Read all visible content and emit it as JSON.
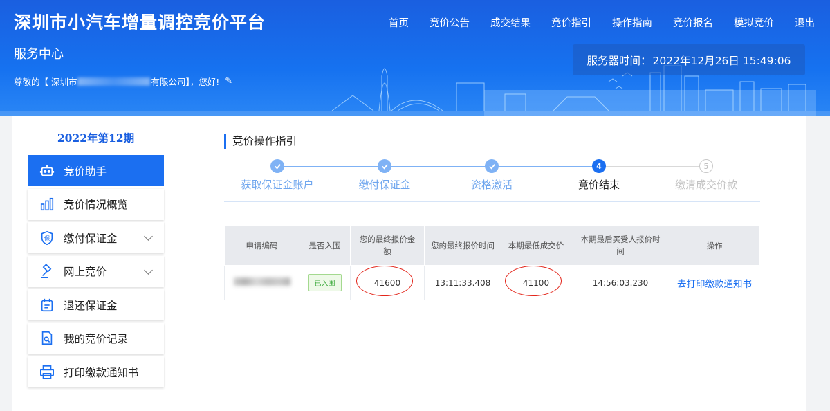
{
  "header": {
    "site_title": "深圳市小汽车增量调控竞价平台",
    "sub_title": "服务中心",
    "greeting_prefix": "尊敬的【 深圳市",
    "greeting_suffix": "有限公司】，您好!",
    "server_time_label": "服务器时间：",
    "server_time_value": "2022年12月26日 15:49:06"
  },
  "nav": [
    "首页",
    "竞价公告",
    "成交结果",
    "竞价指引",
    "操作指南",
    "竞价报名",
    "模拟竞价",
    "退出"
  ],
  "sidebar": {
    "period": "2022年第12期",
    "items": [
      {
        "label": "竞价助手",
        "icon": "robot-icon",
        "active": true
      },
      {
        "label": "竞价情况概览",
        "icon": "bar-chart-icon"
      },
      {
        "label": "缴付保证金",
        "icon": "shield-deposit-icon",
        "has_submenu": true
      },
      {
        "label": "网上竞价",
        "icon": "gavel-icon",
        "has_submenu": true
      },
      {
        "label": "退还保证金",
        "icon": "refund-icon"
      },
      {
        "label": "我的竞价记录",
        "icon": "document-search-icon"
      },
      {
        "label": "打印缴款通知书",
        "icon": "printer-icon"
      }
    ]
  },
  "content": {
    "section_title": "竞价操作指引",
    "steps": [
      {
        "label": "获取保证金账户",
        "status": "done"
      },
      {
        "label": "缴付保证金",
        "status": "done"
      },
      {
        "label": "资格激活",
        "status": "done"
      },
      {
        "label": "竞价结束",
        "status": "current",
        "number": "4"
      },
      {
        "label": "缴清成交价款",
        "status": "todo",
        "number": "5"
      }
    ],
    "table": {
      "headers": [
        "申请编码",
        "是否入围",
        "您的最终报价金额",
        "您的最终报价时间",
        "本期最低成交价",
        "本期最后买受人报价时间",
        "操作"
      ],
      "row": {
        "badge": "已入围",
        "final_bid": "41600",
        "final_bid_time": "13:11:33.408",
        "lowest_price": "41100",
        "last_buyer_time": "14:56:03.230",
        "action": "去打印缴款通知书"
      }
    }
  },
  "colors": {
    "brand_blue": "#1b6ff1",
    "highlight_red": "#e3261b",
    "success_green": "#3daa3d"
  }
}
